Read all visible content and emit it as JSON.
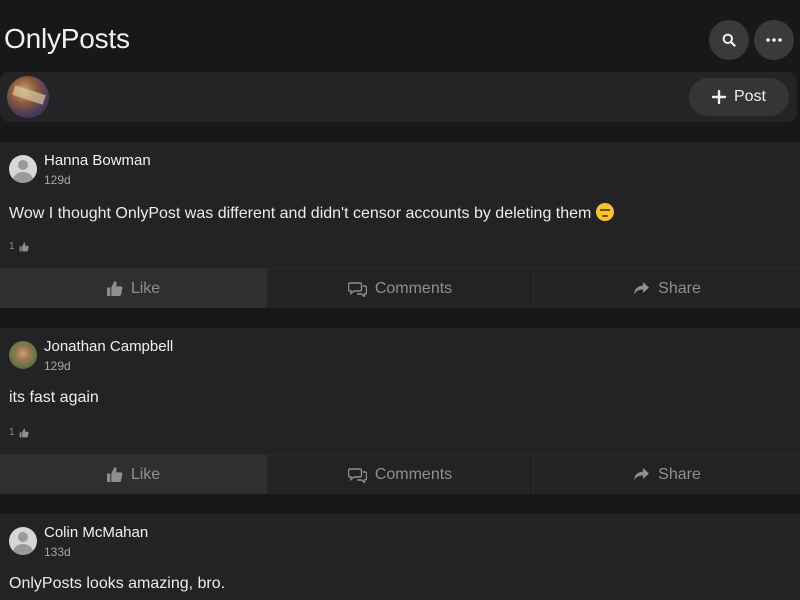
{
  "header": {
    "app_title": "OnlyPosts",
    "search_icon": "search-icon",
    "more_icon": "more-icon"
  },
  "composer": {
    "post_label": "Post",
    "plus_icon": "plus-icon"
  },
  "actions": {
    "like_label": "Like",
    "comments_label": "Comments",
    "share_label": "Share"
  },
  "posts": [
    {
      "author": "Hanna Bowman",
      "age": "129d",
      "text": "Wow I thought OnlyPost was different and didn't censor accounts by deleting them",
      "emoji": "unamused-face",
      "likes": "1"
    },
    {
      "author": "Jonathan Campbell",
      "age": "129d",
      "text": "its fast again",
      "likes": "1"
    },
    {
      "author": "Colin McMahan",
      "age": "133d",
      "text": "OnlyPosts looks amazing, bro."
    }
  ]
}
